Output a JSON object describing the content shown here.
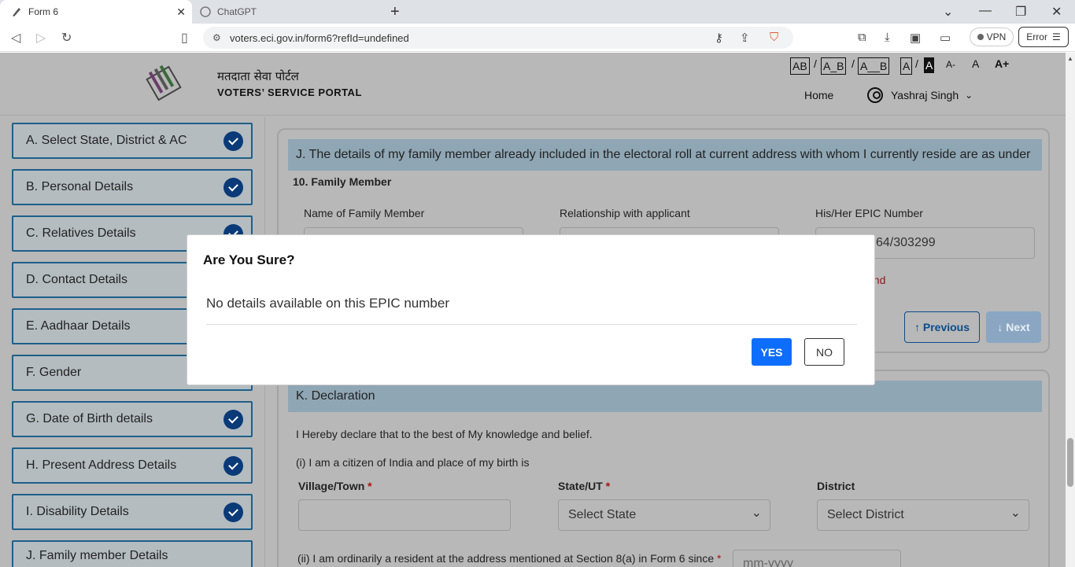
{
  "browser": {
    "tabs": [
      {
        "label": "Form 6"
      },
      {
        "label": "ChatGPT"
      }
    ],
    "url": "voters.eci.gov.in/form6?refId=undefined",
    "vpn_label": "VPN",
    "error_label": "Error"
  },
  "header": {
    "title_hindi": "मतदाता सेवा पोर्टल",
    "title_english": "VOTERS’ SERVICE PORTAL",
    "access": [
      "AB",
      "A_B",
      "A__B",
      "A",
      "A",
      "A-",
      "A",
      "A+"
    ],
    "home": "Home",
    "user_name": "Yashraj Singh"
  },
  "sidebar": {
    "steps": [
      {
        "label": "A. Select State, District & AC"
      },
      {
        "label": "B. Personal Details"
      },
      {
        "label": "C. Relatives Details"
      },
      {
        "label": "D. Contact Details"
      },
      {
        "label": "E. Aadhaar Details"
      },
      {
        "label": "F. Gender"
      },
      {
        "label": "G. Date of Birth details"
      },
      {
        "label": "H. Present Address Details"
      },
      {
        "label": "I. Disability Details"
      },
      {
        "label": "J. Family member Details"
      }
    ]
  },
  "section_j": {
    "heading": "J. The details of my family member already included in the electoral roll at current address with whom I currently reside are as under",
    "item": "10. Family Member",
    "col_name": "Name of Family Member",
    "col_relation": "Relationship with applicant",
    "col_epic": "His/Her EPIC Number",
    "epic_value_visible": "64/303299",
    "error_visible": "und",
    "previous": "Previous",
    "next": "Next"
  },
  "section_k": {
    "heading": "K. Declaration",
    "declare": "I Hereby declare that to the best of My knowledge and belief.",
    "citizen": "(i) I am a citizen of India and place of my birth is",
    "village_label": "Village/Town",
    "state_label": "State/UT",
    "district_label": "District",
    "state_placeholder": "Select State",
    "district_placeholder": "Select District",
    "resident": "(ii) I am ordinarily a resident at the address mentioned at Section 8(a) in Form 6 since",
    "date_placeholder": "mm-yyyy",
    "required_mark": "*"
  },
  "modal": {
    "title": "Are You Sure?",
    "message": "No details available on this EPIC number",
    "yes": "YES",
    "no": "NO"
  }
}
